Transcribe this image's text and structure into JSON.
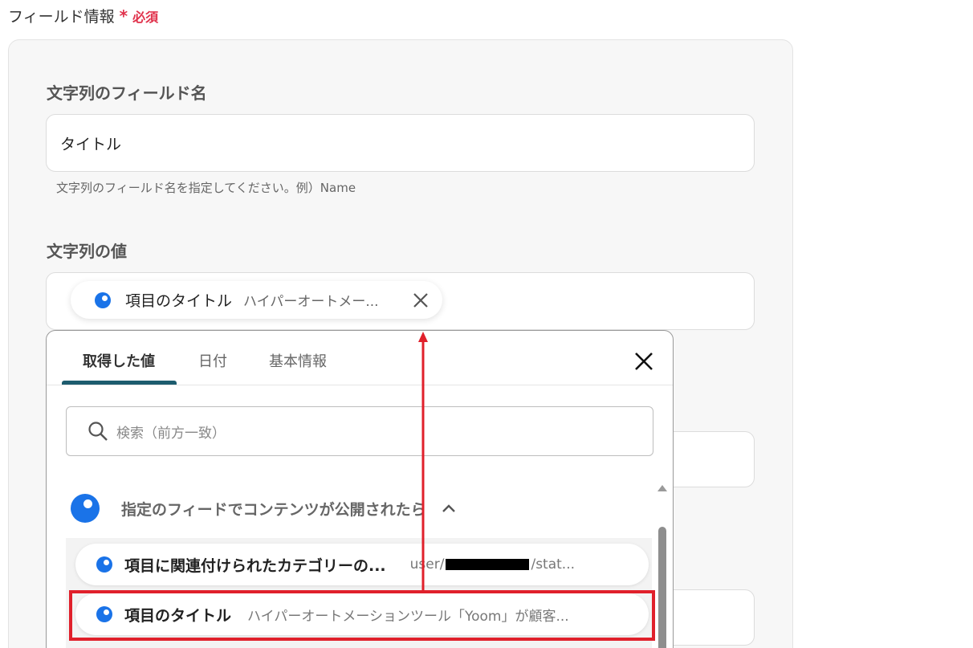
{
  "section": {
    "title": "フィールド情報",
    "required_mark": "*",
    "required_label": "必須"
  },
  "string_field_name": {
    "label": "文字列のフィールド名",
    "value": "タイトル",
    "hint": "文字列のフィールド名を指定してください。例）Name"
  },
  "string_value": {
    "label": "文字列の値",
    "chip": {
      "title": "項目のタイトル",
      "preview": "ハイパーオートメー..."
    }
  },
  "picker": {
    "tabs": [
      {
        "label": "取得した値",
        "active": true
      },
      {
        "label": "日付",
        "active": false
      },
      {
        "label": "基本情報",
        "active": false
      }
    ],
    "search_placeholder": "検索（前方一致）",
    "group": {
      "title": "指定のフィードでコンテンツが公開されたら",
      "items": [
        {
          "title": "項目に関連付けられたカテゴリーの...",
          "value_prefix": "user/",
          "value_suffix": "/stat..."
        },
        {
          "title": "項目のタイトル",
          "value": "ハイパーオートメーションツール「Yoom」が顧客..."
        }
      ]
    }
  },
  "colors": {
    "accent_blue": "#1a73e8",
    "required_red": "#e0314b",
    "annotation_red": "#e0202b",
    "tab_underline": "#1d5c6e"
  },
  "icons": {
    "chip_remove": "close-icon",
    "panel_close": "close-icon",
    "search": "search-icon",
    "group_toggle": "chevron-up-icon"
  }
}
